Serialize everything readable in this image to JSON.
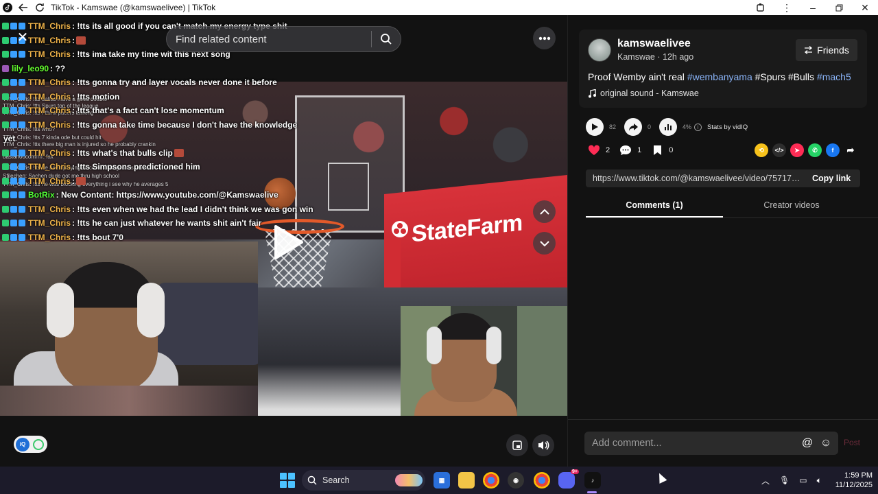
{
  "window": {
    "title": "TikTok - Kamswae (@kamswaelivee) | TikTok"
  },
  "video": {
    "search_placeholder": "Find related content",
    "chat": [
      {
        "user": "TTM_Chris",
        "msg": ": !tts its all good if you can't match my energy type shit",
        "badges": [
          "g",
          "b",
          "b"
        ]
      },
      {
        "user": "TTM_Chris",
        "msg": ":",
        "badges": [
          "g",
          "b",
          "b"
        ],
        "emoji": true
      },
      {
        "user": "TTM_Chris",
        "msg": ": !tts ima take my time wit this next song",
        "badges": [
          "g",
          "b",
          "b"
        ]
      },
      {
        "user": "lily_leo90",
        "msg": ": ??",
        "badges": [
          "p"
        ],
        "cls": "lily"
      },
      {
        "user": "TTM_Chris",
        "msg": ": !tts gonna try and layer vocals never done it before",
        "badges": [
          "g",
          "b",
          "b"
        ]
      },
      {
        "user": "TTM_Chris",
        "msg": ": !tts motion",
        "badges": [
          "g",
          "b",
          "b"
        ]
      },
      {
        "user": "TTM_Chris",
        "msg": ": !tts that's a fact can't lose momentum",
        "badges": [
          "g",
          "b",
          "b"
        ]
      },
      {
        "user": "TTM_Chris",
        "msg": ": !tts gonna take time because I don't have the knowledge",
        "badges": [
          "g",
          "b",
          "b"
        ]
      },
      {
        "user": "",
        "msg": "yet",
        "badges": []
      },
      {
        "user": "TTM_Chris",
        "msg": ": !tts what's that bulls clip",
        "badges": [
          "g",
          "b",
          "b"
        ],
        "emoji": true
      },
      {
        "user": "TTM_Chris",
        "msg": ": !tts Simpsons predictioned him",
        "badges": [
          "g",
          "b",
          "b"
        ]
      },
      {
        "user": "TTM_Chris",
        "msg": ":",
        "badges": [
          "g",
          "b",
          "b"
        ],
        "emoji": true
      },
      {
        "user": "BotRix",
        "msg": ": New Content: https://www.youtube.com/@Kamswaelive",
        "badges": [
          "g",
          "b",
          "b"
        ],
        "cls": "bot"
      },
      {
        "user": "TTM_Chris",
        "msg": ": !tts even when we had the lead I didn't think we was gon win",
        "badges": [
          "g",
          "b",
          "b"
        ]
      },
      {
        "user": "TTM_Chris",
        "msg": ": !tts he can just whatever he wants shit ain't fair",
        "badges": [
          "g",
          "b",
          "b"
        ]
      },
      {
        "user": "TTM_Chris",
        "msg": ": !tts bout 7'0",
        "badges": [
          "g",
          "b",
          "b"
        ]
      }
    ],
    "ghost_lines": [
      "TTM_Chris: !tts dallas mavs a good double",
      "TTM_Chris: !tts Spurs top of the league",
      "TTM_Chris: !tts I think pacers tanking",
      "TTM_Chris: !tts who?",
      "TTM_Chris: !tts 7 kinda ode but could hit",
      "TTM_Chris: !tts there big man is injured so he probably crankin",
      "dastan00comrrrr: fax",
      "TTM_Chris: !tts he been playing since he changed his name",
      "Sfilechen: Sachen dude got me thru high school",
      "TTM_Chris: !tts he was blocking everything i see why he averages 5"
    ],
    "scoreboard_text": "StateFarm",
    "vidiq_knob": "iQ"
  },
  "panel": {
    "username": "kamswaelivee",
    "display_name": "Kamswae",
    "time_ago": "12h ago",
    "meta_sep": " · ",
    "friends_label": "Friends",
    "description_plain": "Proof Wemby ain't real ",
    "tags": [
      "#wembanyama",
      "#Spurs",
      "#Bulls",
      "#mach5"
    ],
    "sound": "original sound - Kamswae",
    "stats": {
      "plays": "82",
      "shares": "0",
      "engagement": "4%",
      "label": "Stats by vidIQ"
    },
    "actions": {
      "likes": "2",
      "comments": "1",
      "saves": "0"
    },
    "link": "https://www.tiktok.com/@kamswaelivee/video/7571733...",
    "copy_label": "Copy link",
    "tabs": [
      "Comments (1)",
      "Creator videos"
    ],
    "comment_placeholder": "Add comment...",
    "post_label": "Post"
  },
  "taskbar": {
    "search_label": "Search",
    "time": "1:59 PM",
    "date": "11/12/2025",
    "discord_badge": "9+"
  },
  "colors": {
    "accent_tag": "#8ab4f8",
    "like": "#fe2c55",
    "chat_user": "#f0b44a"
  }
}
